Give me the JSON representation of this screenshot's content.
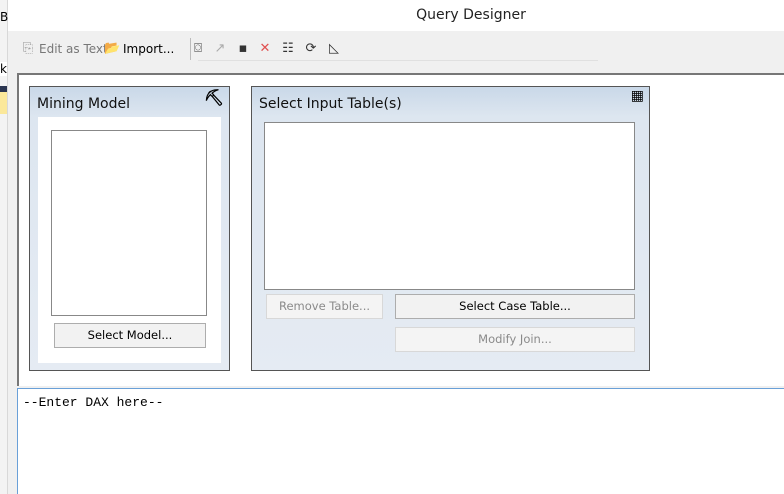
{
  "window": {
    "title": "Query Designer"
  },
  "left_strip": {
    "fragments": [
      "B",
      "k"
    ]
  },
  "toolbar": {
    "edit_as_text": "Edit as Text",
    "import": "Import...",
    "icons": [
      "query-mode-icon",
      "pick-model-icon",
      "add-table-icon",
      "delete-icon",
      "parameters-icon",
      "refresh-icon",
      "result-icon"
    ]
  },
  "mining_model": {
    "title": "Mining Model",
    "select_button": "Select Model..."
  },
  "input_tables": {
    "title": "Select Input Table(s)",
    "remove_button": "Remove Table...",
    "select_case_button": "Select Case Table...",
    "modify_join_button": "Modify Join..."
  },
  "editor": {
    "text": "--Enter DAX here--"
  }
}
